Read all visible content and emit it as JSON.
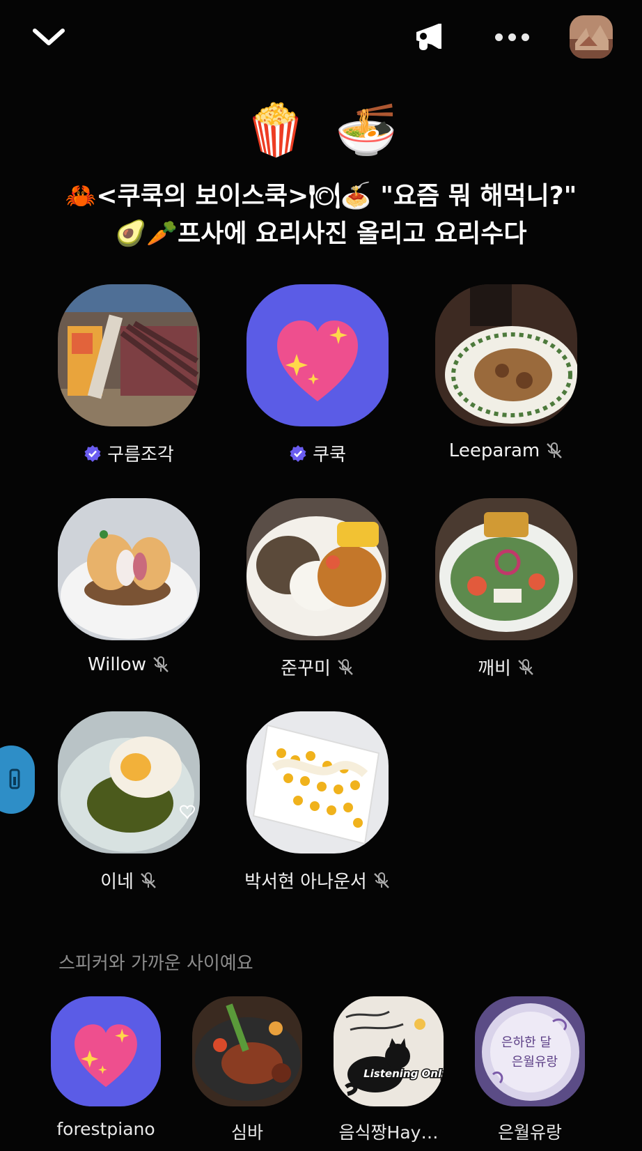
{
  "room": {
    "title_emoji": [
      "🍿",
      "🍜"
    ],
    "title_line1": "🦀<쿠쿡의 보이스쿡>🍽🍝 \"요즘 뭐 해먹니?\"",
    "title_line2": "🥑🥕프사에 요리사진 올리고 요리수다"
  },
  "icons": {
    "back": "chevron-down-icon",
    "announce": "megaphone-icon",
    "more": "more-dots-icon",
    "side": "mic-icon"
  },
  "speakers": [
    {
      "name": "구름조각",
      "verified": true,
      "muted": false,
      "avatar": "food-steak-photo"
    },
    {
      "name": "쿠쿡",
      "verified": true,
      "muted": false,
      "avatar": "sparkling-heart"
    },
    {
      "name": "Leeparam",
      "verified": false,
      "muted": true,
      "avatar": "food-curry-photo"
    },
    {
      "name": "Willow",
      "verified": false,
      "muted": true,
      "avatar": "food-peach-photo"
    },
    {
      "name": "준꾸미",
      "verified": false,
      "muted": true,
      "avatar": "food-rice-curry-photo"
    },
    {
      "name": "깨비",
      "verified": false,
      "muted": true,
      "avatar": "food-salad-photo"
    },
    {
      "name": "이네",
      "verified": false,
      "muted": true,
      "avatar": "food-egg-photo"
    },
    {
      "name": "박서현 아나운서",
      "verified": false,
      "muted": true,
      "avatar": "food-corn-photo"
    }
  ],
  "listeners_section": {
    "label": "스피커와 가까운 사이예요",
    "items": [
      {
        "name": "forestpiano",
        "avatar": "sparkling-heart"
      },
      {
        "name": "심바",
        "avatar": "food-grill-photo"
      },
      {
        "name": "음식짱Hay…",
        "avatar": "cat-photo"
      },
      {
        "name": "은월유랑",
        "avatar": "moon-text-image"
      }
    ],
    "cat_image_text": "Listening Only",
    "moon_image_text": [
      "은하한 달",
      "은월유랑"
    ]
  },
  "colors": {
    "background": "#050505",
    "heart_tile": "#5b5ce6",
    "verified": "#6a5cf0",
    "side_tab": "#2e8ec7"
  }
}
